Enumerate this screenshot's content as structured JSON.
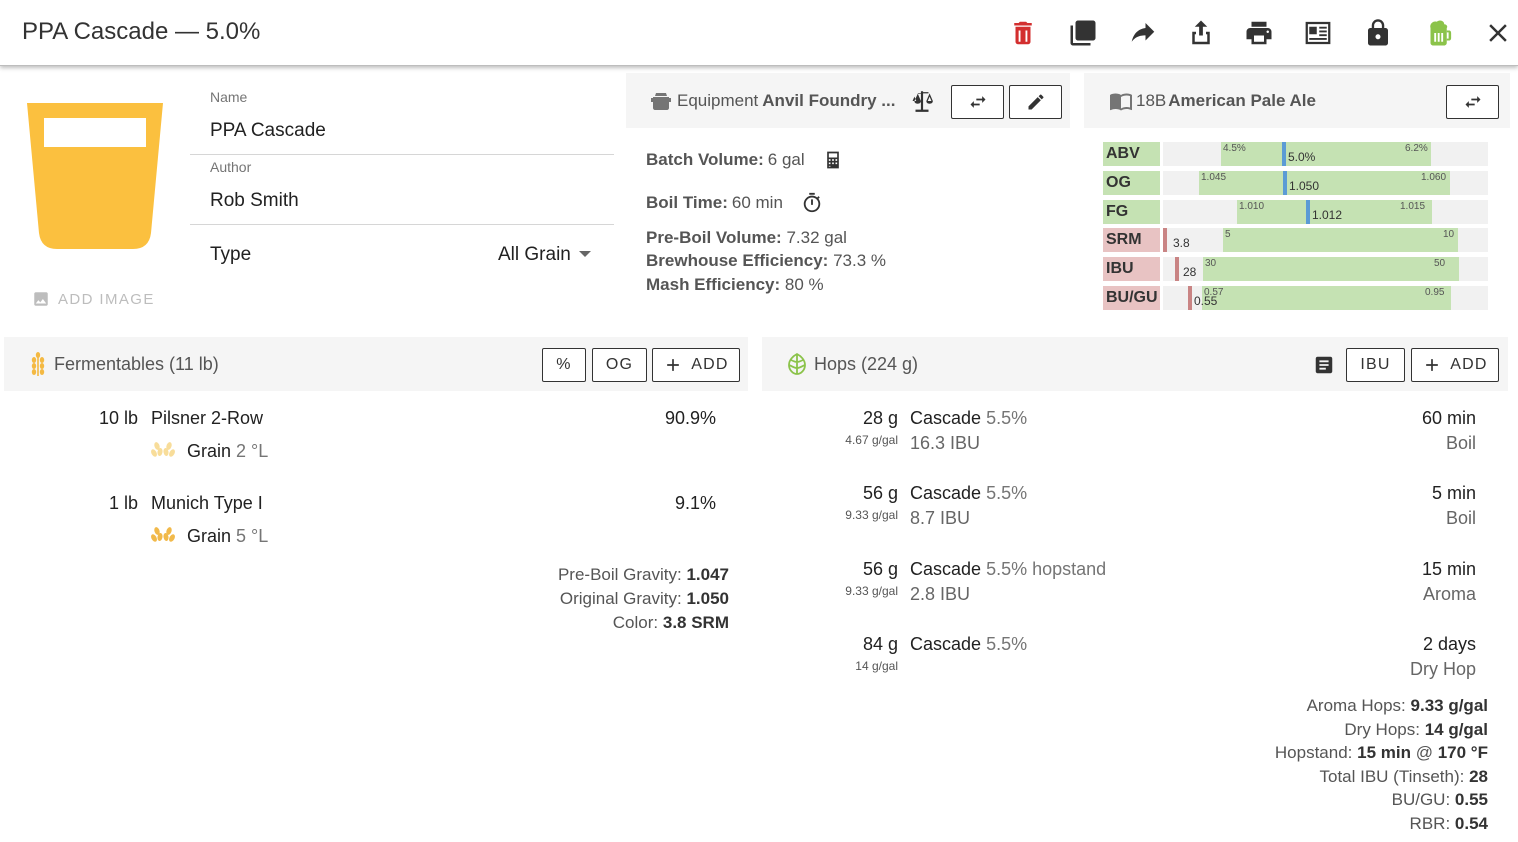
{
  "title": "PPA Cascade — 5.0%",
  "toolbar": {
    "icons": [
      "delete-icon",
      "copy-icon",
      "share-icon",
      "export-icon",
      "print-icon",
      "brew-sheet-icon",
      "lock-icon",
      "brew-icon",
      "close-icon"
    ],
    "delete_color": "#d32f2f",
    "brew_color": "#8bc34a"
  },
  "recipe": {
    "name_label": "Name",
    "name": "PPA Cascade",
    "author_label": "Author",
    "author": "Rob Smith",
    "type_label": "Type",
    "type": "All Grain",
    "add_image": "ADD IMAGE",
    "glass_color": "#fbc03f"
  },
  "equipment": {
    "prefix": "Equipment",
    "name": "Anvil Foundry ...",
    "batch_volume_label": "Batch Volume:",
    "batch_volume": "6 gal",
    "boil_time_label": "Boil Time:",
    "boil_time": "60 min",
    "pre_boil_volume_label": "Pre-Boil Volume:",
    "pre_boil_volume": "7.32 gal",
    "brewhouse_eff_label": "Brewhouse Efficiency:",
    "brewhouse_eff": "73.3 %",
    "mash_eff_label": "Mash Efficiency:",
    "mash_eff": "80 %"
  },
  "style": {
    "code": "18B",
    "name": "American Pale Ale",
    "stats": [
      {
        "name": "ABV",
        "lo": "4.5%",
        "hi": "6.2%",
        "val": "5.0%",
        "in_range": true
      },
      {
        "name": "OG",
        "lo": "1.045",
        "hi": "1.060",
        "val": "1.050",
        "in_range": true
      },
      {
        "name": "FG",
        "lo": "1.010",
        "hi": "1.015",
        "val": "1.012",
        "in_range": true
      },
      {
        "name": "SRM",
        "lo": "5",
        "hi": "10",
        "val": "3.8",
        "in_range": false
      },
      {
        "name": "IBU",
        "lo": "30",
        "hi": "50",
        "val": "28",
        "in_range": false
      },
      {
        "name": "BU/GU",
        "lo": "0.57",
        "hi": "0.95",
        "val": "0.55",
        "in_range": false
      }
    ],
    "colors": {
      "range": "#c5e2b3",
      "in": "#5b9bd5",
      "out": "#c98484",
      "label_in": "#c5e2b3",
      "label_out": "#e8c3c3"
    }
  },
  "fermentables": {
    "title": "Fermentables (11 lb)",
    "btn_percent": "%",
    "btn_og": "OG",
    "btn_add": "ADD",
    "items": [
      {
        "amount": "10 lb",
        "name": "Pilsner 2-Row",
        "percent": "90.9%",
        "kind": "Grain",
        "color": "2 °L"
      },
      {
        "amount": "1 lb",
        "name": "Munich Type I",
        "percent": "9.1%",
        "kind": "Grain",
        "color": "5 °L"
      }
    ],
    "pre_boil_gravity_label": "Pre-Boil Gravity:",
    "pre_boil_gravity": "1.047",
    "og_label": "Original Gravity:",
    "og": "1.050",
    "color_label": "Color:",
    "color": "3.8 SRM"
  },
  "hops": {
    "title": "Hops (224 g)",
    "btn_ibu": "IBU",
    "btn_add": "ADD",
    "items": [
      {
        "amount": "28 g",
        "rate": "4.67 g/gal",
        "name": "Cascade",
        "alpha": "5.5%",
        "extra": "",
        "ibu": "16.3 IBU",
        "time": "60 min",
        "use": "Boil"
      },
      {
        "amount": "56 g",
        "rate": "9.33 g/gal",
        "name": "Cascade",
        "alpha": "5.5%",
        "extra": "",
        "ibu": "8.7 IBU",
        "time": "5 min",
        "use": "Boil"
      },
      {
        "amount": "56 g",
        "rate": "9.33 g/gal",
        "name": "Cascade",
        "alpha": "5.5%",
        "extra": "hopstand",
        "ibu": "2.8 IBU",
        "time": "15 min",
        "use": "Aroma"
      },
      {
        "amount": "84 g",
        "rate": "14 g/gal",
        "name": "Cascade",
        "alpha": "5.5%",
        "extra": "",
        "ibu": "",
        "time": "2 days",
        "use": "Dry Hop"
      }
    ],
    "aroma_label": "Aroma Hops:",
    "aroma": "9.33 g/gal",
    "dry_label": "Dry Hops:",
    "dry": "14 g/gal",
    "hopstand_label": "Hopstand:",
    "hopstand_time": "15 min",
    "hopstand_at": "@",
    "hopstand_temp": "170 °F",
    "total_ibu_label": "Total IBU (Tinseth):",
    "total_ibu": "28",
    "bugu_label": "BU/GU:",
    "bugu": "0.55",
    "rbr_label": "RBR:",
    "rbr": "0.54"
  }
}
